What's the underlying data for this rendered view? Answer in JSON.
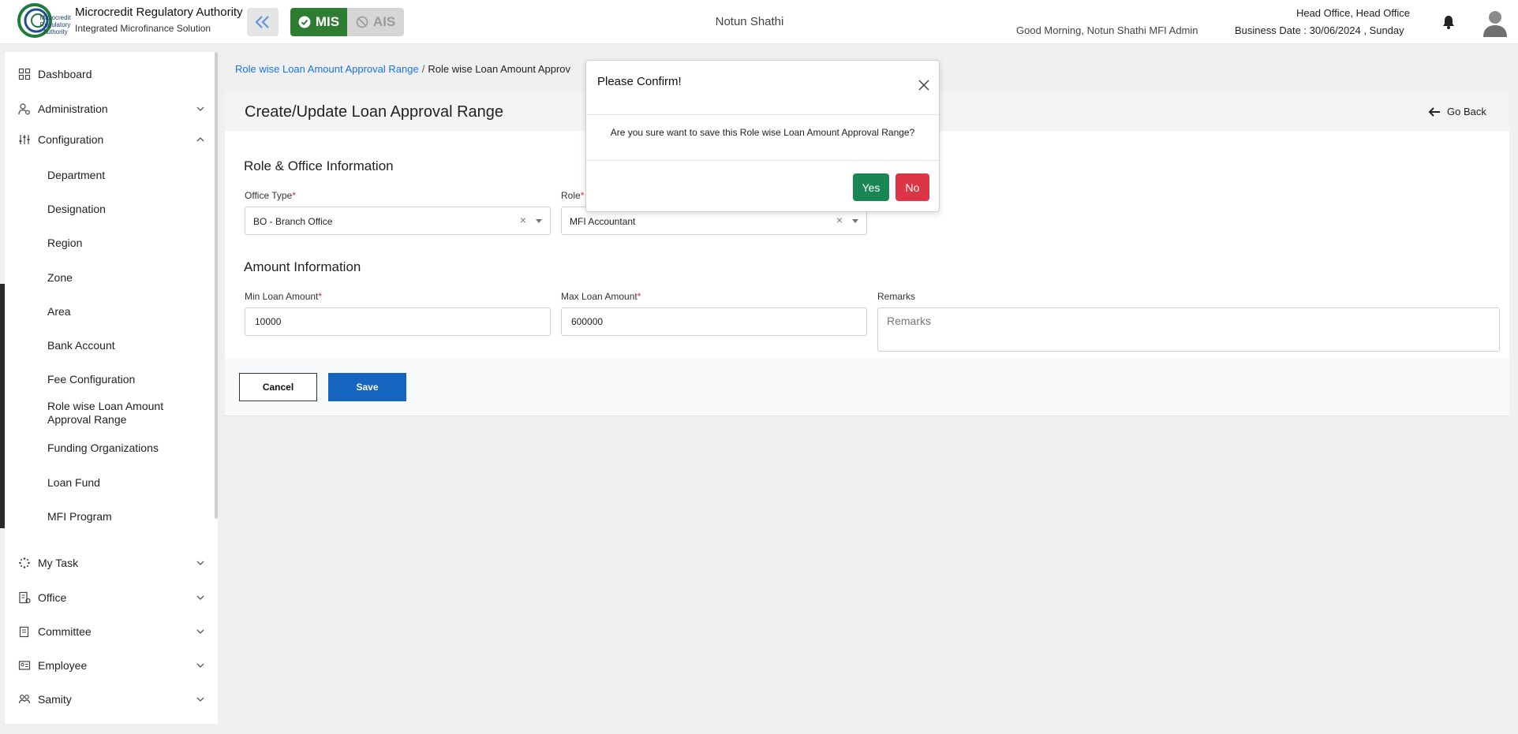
{
  "header": {
    "org_name": "Microcredit Regulatory Authority",
    "org_subtitle": "Integrated Microfinance Solution",
    "logo_text": "Microcredit Regulatory Authority",
    "mode_mis": "MIS",
    "mode_ais": "AIS",
    "center_title": "Notun Shathi",
    "greeting": "Good Morning, Notun Shathi MFI Admin",
    "office": "Head Office, Head Office",
    "business_date": "Business Date : 30/06/2024 , Sunday",
    "colors": {
      "mis_active": "#2e7d32",
      "ais_inactive": "#d6d6d6"
    }
  },
  "sidebar": {
    "items": [
      {
        "label": "Dashboard",
        "icon": "grid-icon"
      },
      {
        "label": "Administration",
        "icon": "users-cog-icon"
      },
      {
        "label": "Configuration",
        "icon": "sliders-icon"
      },
      {
        "label": "My Task",
        "icon": "spinner-icon"
      },
      {
        "label": "Office",
        "icon": "building-icon"
      },
      {
        "label": "Committee",
        "icon": "clipboard-icon"
      },
      {
        "label": "Employee",
        "icon": "id-card-icon"
      },
      {
        "label": "Samity",
        "icon": "group-icon"
      }
    ],
    "config_sub": [
      "Department",
      "Designation",
      "Region",
      "Zone",
      "Area",
      "Bank Account",
      "Fee Configuration",
      "Role wise Loan Amount Approval Range",
      "Funding Organizations",
      "Loan Fund",
      "MFI Program"
    ]
  },
  "breadcrumb": {
    "link": "Role wise Loan Amount Approval Range",
    "separator": "/",
    "current": "Role wise Loan Amount Approv"
  },
  "page": {
    "title": "Create/Update Loan Approval Range",
    "go_back": "Go Back"
  },
  "form": {
    "section1": "Role & Office Information",
    "office_type_label": "Office Type",
    "office_type_value": "BO - Branch Office",
    "role_label": "Role",
    "role_value": "MFI Accountant",
    "section2": "Amount Information",
    "min_label": "Min Loan Amount",
    "min_value": "10000",
    "max_label": "Max Loan Amount",
    "max_value": "600000",
    "remarks_label": "Remarks",
    "remarks_placeholder": "Remarks",
    "required_mark": "*",
    "clear_glyph": "×",
    "cancel": "Cancel",
    "save": "Save"
  },
  "modal": {
    "title": "Please Confirm!",
    "message": "Are you sure want to save this Role wise Loan Amount Approval Range?",
    "yes": "Yes",
    "no": "No",
    "colors": {
      "yes": "#198754",
      "no": "#dc3545"
    }
  }
}
